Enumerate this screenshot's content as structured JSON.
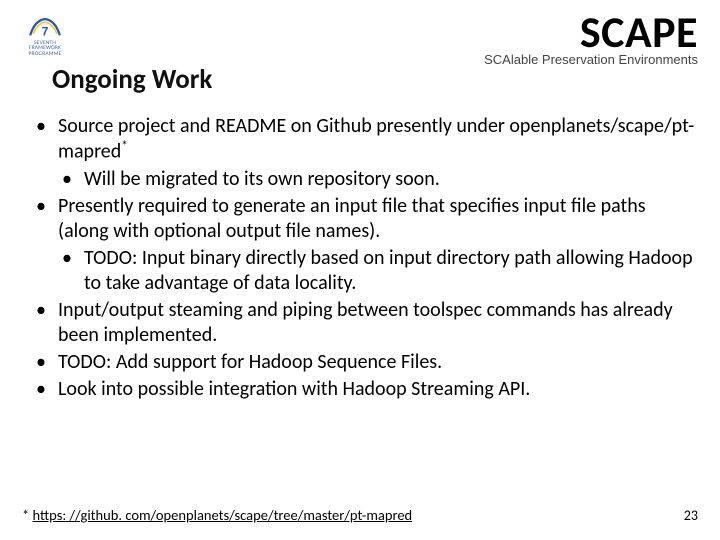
{
  "logo": {
    "caption_line1": "SEVENTH FRAMEWORK",
    "caption_line2": "PROGRAMME"
  },
  "brand": {
    "name": "SCAPE",
    "tagline": "SCAlable Preservation Environments"
  },
  "title": "Ongoing Work",
  "bullets": [
    {
      "text_a": "Source project and README on Github presently under openplanets/scape/pt-mapred",
      "sup": "*",
      "children": [
        {
          "text": "Will be migrated to its own repository soon."
        }
      ]
    },
    {
      "text_a": "Presently required to generate an input file that specifies input file paths (along with optional output file names).",
      "children": [
        {
          "text": "TODO: Input binary directly based on input directory path allowing Hadoop to take advantage of data locality."
        }
      ]
    },
    {
      "text_a": "Input/output steaming and piping between toolspec commands has already been implemented."
    },
    {
      "text_a": "TODO: Add support for Hadoop Sequence Files."
    },
    {
      "text_a": "Look into possible integration with Hadoop Streaming API."
    }
  ],
  "footnote": {
    "marker": "* ",
    "url_text": "https: //github. com/openplanets/scape/tree/master/pt-mapred"
  },
  "page_number": "23"
}
